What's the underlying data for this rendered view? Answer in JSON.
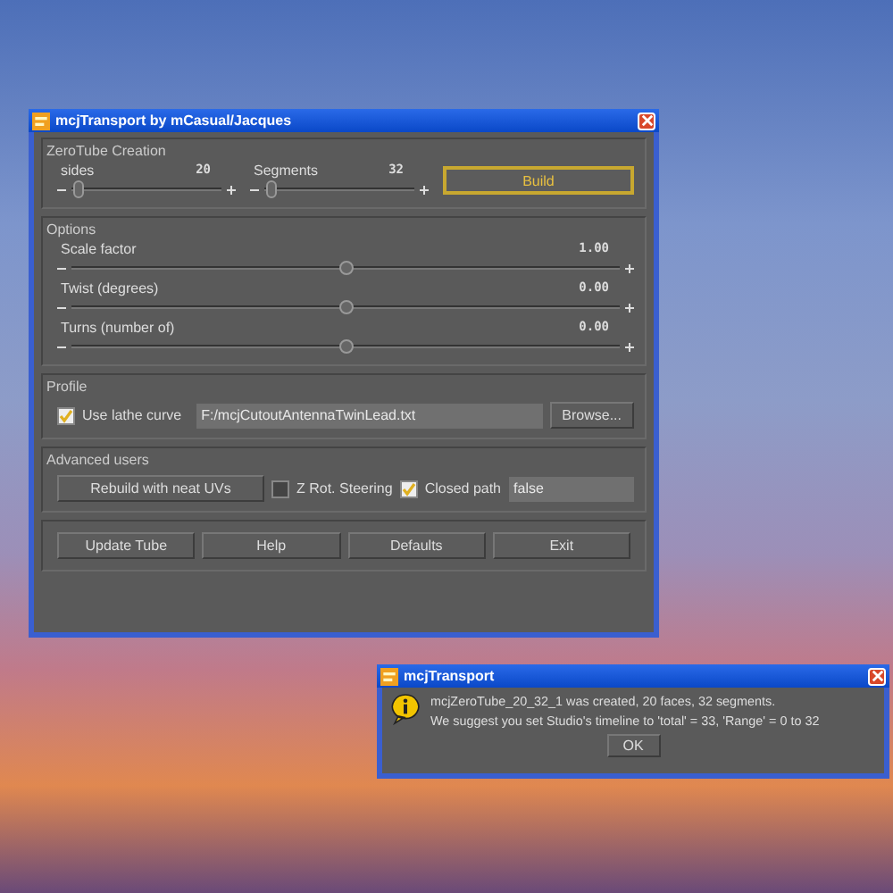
{
  "main_window": {
    "title": "mcjTransport by mCasual/Jacques",
    "zerotube": {
      "legend": "ZeroTube Creation",
      "sliders": [
        {
          "label": "sides",
          "reading": "20",
          "level": 0.05
        },
        {
          "label": "Segments",
          "reading": "32",
          "level": 0.05
        }
      ],
      "build_button": "Build"
    },
    "options": {
      "legend": "Options",
      "sliders": [
        {
          "label": "Scale factor",
          "reading": "1.00",
          "level": 0.5
        },
        {
          "label": "Twist (degrees)",
          "reading": "0.00",
          "level": 0.5
        },
        {
          "label": "Turns (number of)",
          "reading": "0.00",
          "level": 0.5
        }
      ]
    },
    "profile": {
      "legend": "Profile",
      "checkbox": {
        "label": "Use lathe curve",
        "checked": true
      },
      "path": "F:/mcjCutoutAntennaTwinLead.txt",
      "browse_button": "Browse..."
    },
    "advanced": {
      "legend": "Advanced users",
      "rebuild_button": "Rebuild with neat UVs",
      "checkboxes": [
        {
          "label": "Z Rot. Steering",
          "checked": false
        },
        {
          "label": "Closed path",
          "checked": true
        }
      ],
      "value": "false"
    },
    "buttons": [
      "Update Tube",
      "Help",
      "Defaults",
      "Exit"
    ]
  },
  "dialog": {
    "title": "mcjTransport",
    "lines": [
      "mcjZeroTube_20_32_1 was created, 20 faces, 32 segments.",
      "We suggest you set Studio's timeline to 'total' = 33, 'Range' = 0 to 32"
    ],
    "button": "OK"
  }
}
